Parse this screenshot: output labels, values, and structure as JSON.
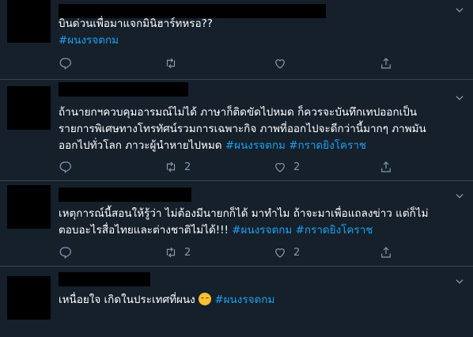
{
  "tweets": [
    {
      "line1": "บินด่วนเพื่อมาแจกมินิฮาร์ทหรอ??",
      "line2": "",
      "tag1": "#ผนงรจตกม",
      "tag2": "",
      "reply_count": "",
      "retweet_count": "",
      "like_count": ""
    },
    {
      "line1": "ถ้านายกฯควบคุมอารมณ์ไม่ได้ ภาษาก็ติดขัดไปหมด ก็ควรจะบันทึกเทปออกเป็น",
      "line2": "รายการพิเศษทางโทรทัศน์รวมการเฉพาะกิจ ภาพที่ออกไปจะดีกว่านี้มากๆ ภาพมัน",
      "line3": "ออกไปทั่วโลก ภาวะผู้นำหายไปหมด",
      "tag1": "#ผนงรจตกม",
      "tag2": "#กราดยิงโคราช",
      "reply_count": "",
      "retweet_count": "2",
      "like_count": "2"
    },
    {
      "line1": "เหตุการณ์นี้สอนให้รู้ว่า ไม่ต้องมีนายกก็ได้ มาทำไม ถ้าจะมาเพื่อแถลงข่าว แต่ก็ไม่",
      "line2": "ตอบอะไรสื่อไทยและต่างชาติไม่ได้!!!",
      "tag1": "#ผนงรจตกม",
      "tag2": "#กราดยิงโคราช",
      "reply_count": "",
      "retweet_count": "2",
      "like_count": "2"
    },
    {
      "line1": "เหนื่อยใจ เกิดในประเทศที่ผนง",
      "emoji": "pensive-face",
      "tag1": "#ผนงรจตกม"
    }
  ],
  "colors": {
    "background": "#15202b",
    "text": "#ffffff",
    "hashtag": "#1da1f2",
    "muted": "#8899a6",
    "divider": "#38444d"
  },
  "icons": [
    "reply-icon",
    "retweet-icon",
    "like-icon",
    "share-icon",
    "chevron-down-icon"
  ]
}
